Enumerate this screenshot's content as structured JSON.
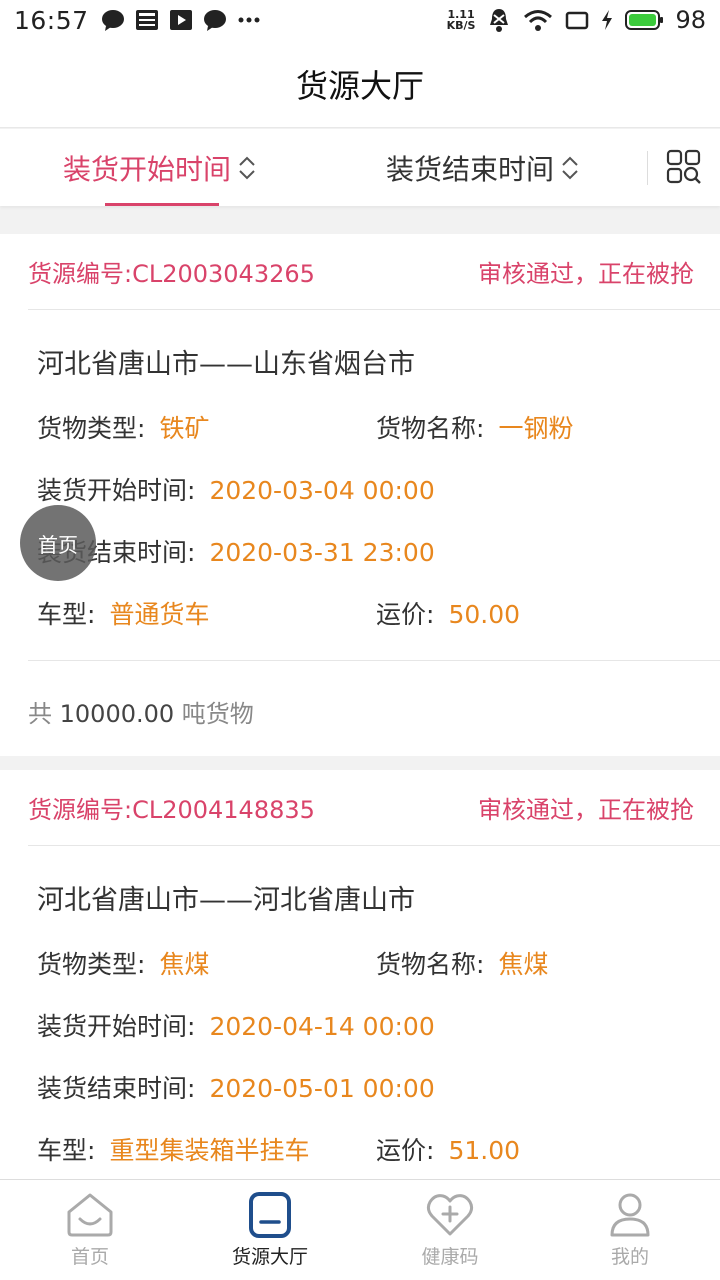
{
  "status_bar": {
    "time": "16:57",
    "net_speed_value": "1.11",
    "net_speed_unit": "KB/S",
    "battery": "98",
    "icons": [
      "chat-bubble-icon",
      "news-icon",
      "play-icon",
      "chat-bubble-icon",
      "more-dots-icon",
      "mute-bell-icon",
      "wifi-icon",
      "screen-icon",
      "charging-icon",
      "battery-icon"
    ]
  },
  "header": {
    "title": "货源大厅"
  },
  "filters": {
    "start_time": "装货开始时间",
    "end_time": "装货结束时间",
    "icon": "grid-search-icon"
  },
  "labels": {
    "cargo_type": "货物类型:",
    "cargo_name": "货物名称:",
    "load_start": "装货开始时间:",
    "load_end": "装货结束时间:",
    "vehicle": "车型:",
    "freight": "运价:",
    "total_prefix": "共",
    "total_suffix": "吨货物"
  },
  "cards": [
    {
      "code": "货源编号:CL2003043265",
      "status": "审核通过，正在被抢",
      "route": "河北省唐山市——山东省烟台市",
      "cargo_type": "铁矿",
      "cargo_name": "一钢粉",
      "load_start": "2020-03-04 00:00",
      "load_end": "2020-03-31 23:00",
      "vehicle": "普通货车",
      "freight": "50.00",
      "total": "10000.00"
    },
    {
      "code": "货源编号:CL2004148835",
      "status": "审核通过，正在被抢",
      "route": "河北省唐山市——河北省唐山市",
      "cargo_type": "焦煤",
      "cargo_name": "焦煤",
      "load_start": "2020-04-14 00:00",
      "load_end": "2020-05-01 00:00",
      "vehicle": "重型集装箱半挂车",
      "freight": "51.00"
    }
  ],
  "float_button": {
    "label": "首页"
  },
  "bottom_nav": [
    {
      "label": "首页",
      "icon": "home-icon"
    },
    {
      "label": "货源大厅",
      "icon": "cargo-hall-icon"
    },
    {
      "label": "健康码",
      "icon": "health-heart-icon"
    },
    {
      "label": "我的",
      "icon": "profile-icon"
    }
  ],
  "colors": {
    "accent": "#d9436a",
    "value": "#e8871e",
    "nav_active": "#1f4e8c"
  }
}
